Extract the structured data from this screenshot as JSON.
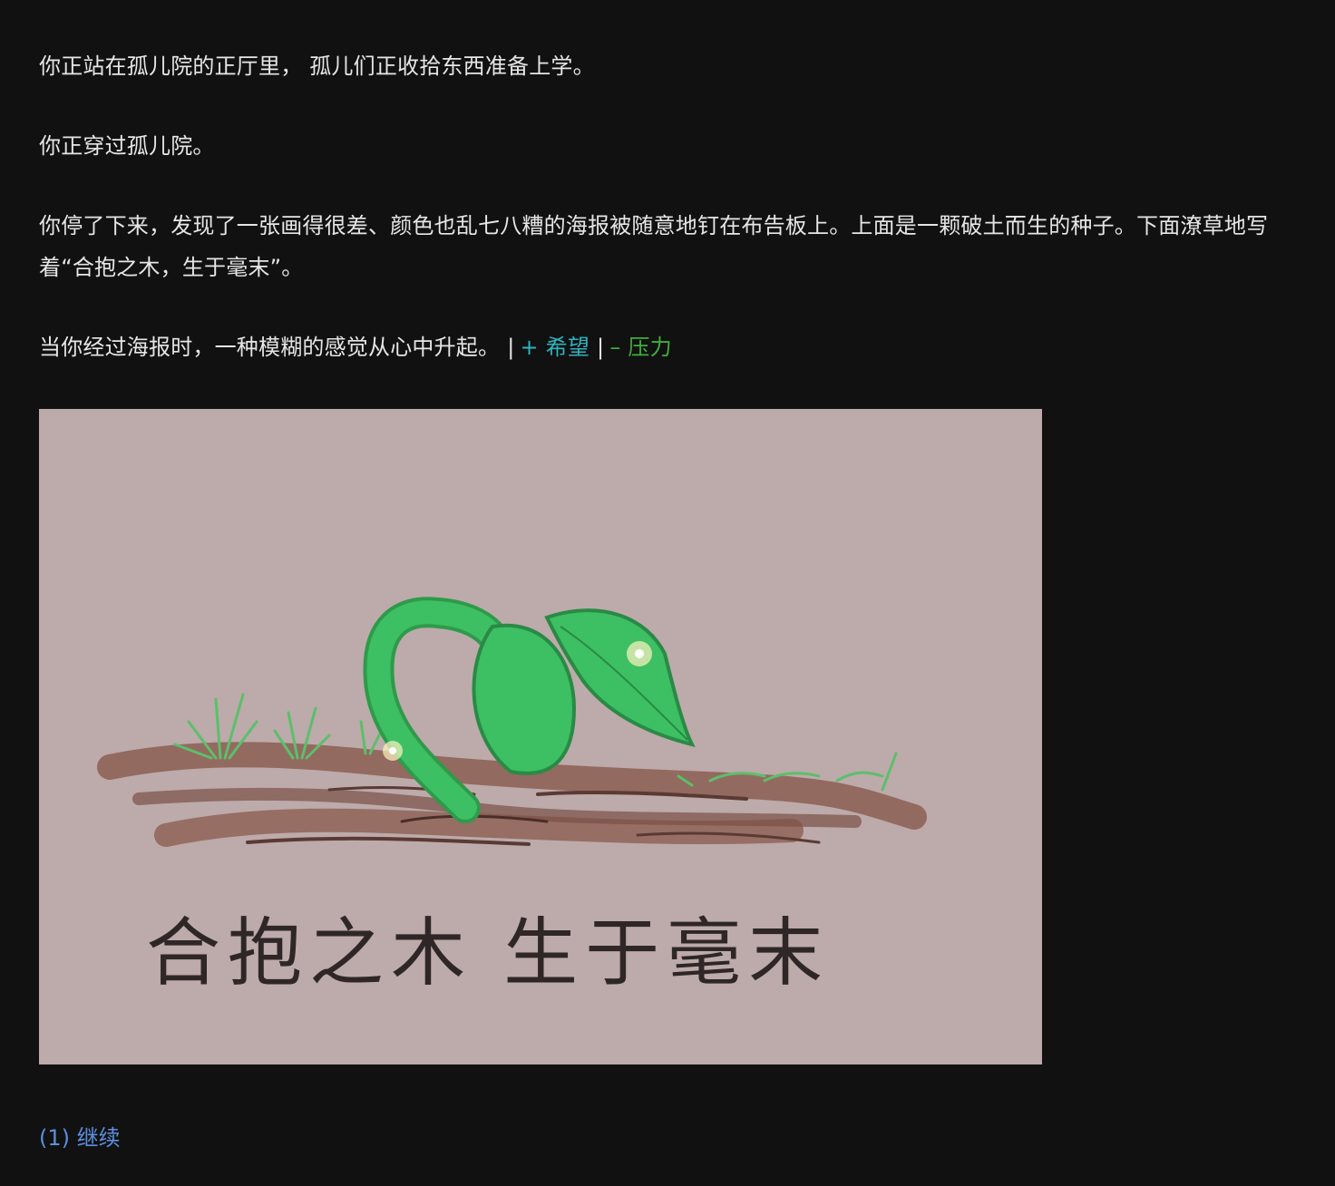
{
  "story": {
    "p1": "你正站在孤儿院的正厅里， 孤儿们正收拾东西准备上学。",
    "p2": "你正穿过孤儿院。",
    "p3": "你停了下来，发现了一张画得很差、颜色也乱七八糟的海报被随意地钉在布告板上。上面是一颗破土而生的种子。下面潦草地写着“合抱之木，生于毫末”。",
    "p4": "当你经过海报时，一种模糊的感觉从心中升起。"
  },
  "effects": {
    "separator": "|",
    "hope": "+ 希望",
    "stress": "– 压力",
    "hope_color": "#2fb3bd",
    "stress_color": "#3fae3a"
  },
  "poster": {
    "caption": "合抱之木  生于毫末",
    "background": "#bdaaab"
  },
  "choices": [
    {
      "label": "(1) 继续"
    }
  ]
}
